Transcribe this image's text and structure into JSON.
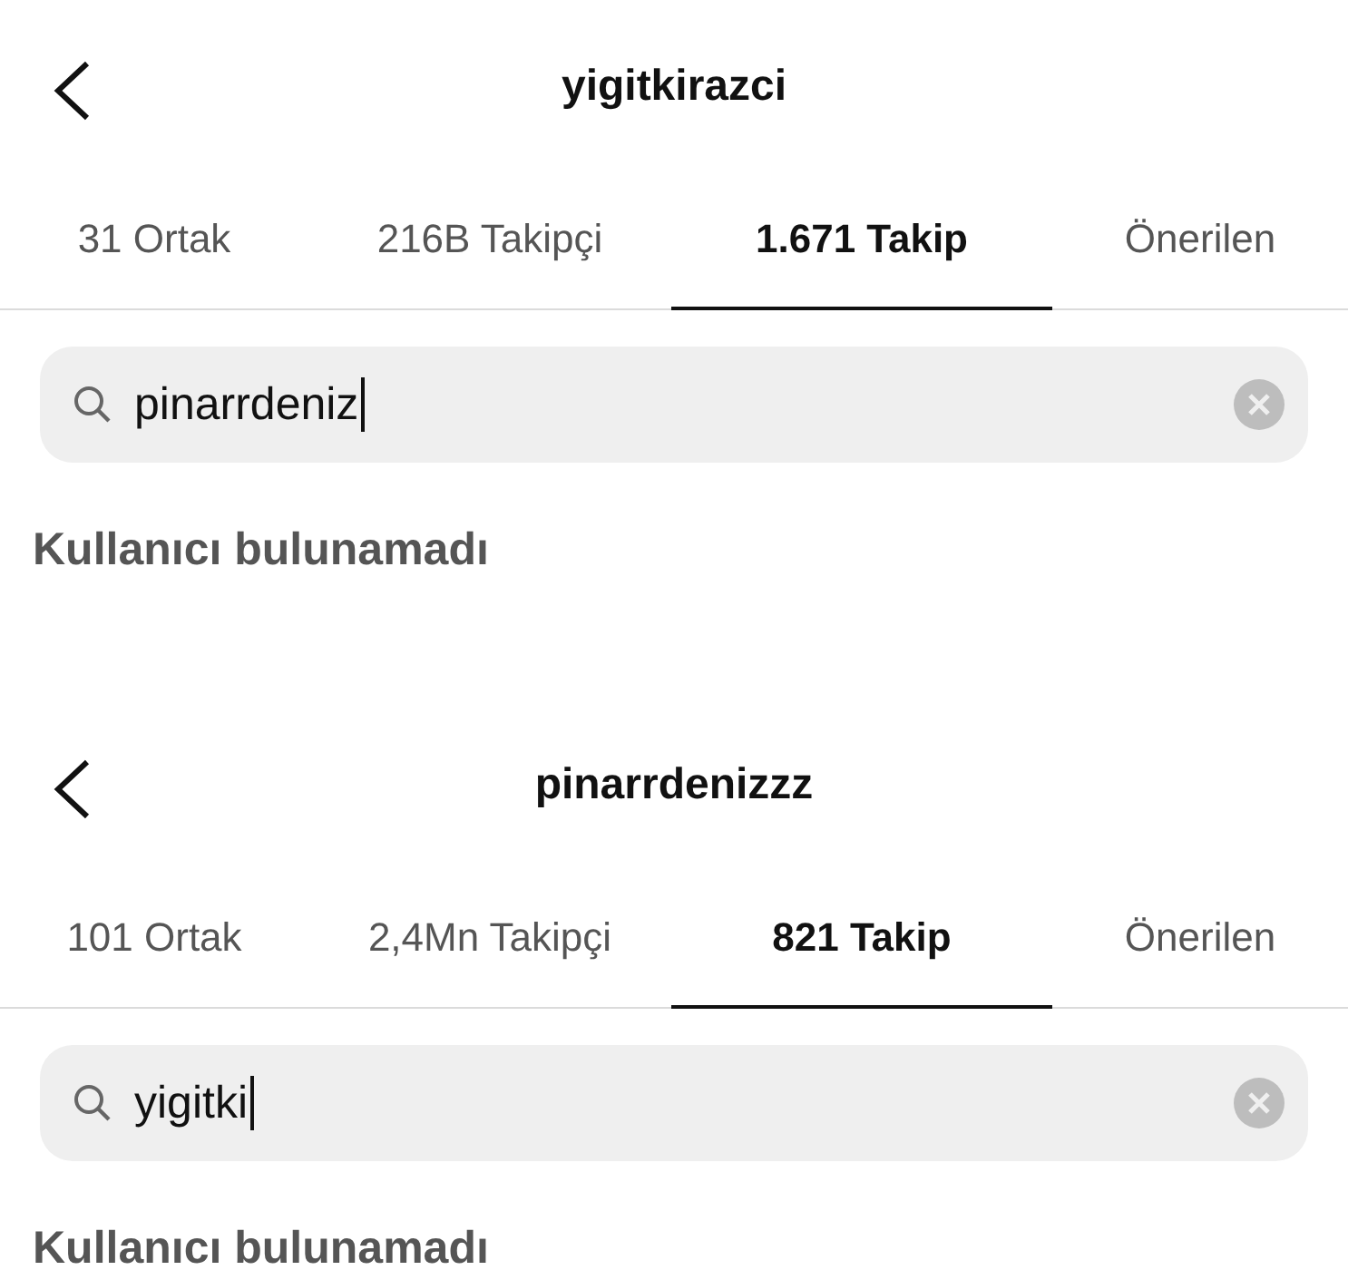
{
  "panels": [
    {
      "title": "yigitkirazci",
      "tabs": [
        {
          "label": "31 Ortak",
          "selected": false
        },
        {
          "label": "216B Takipçi",
          "selected": false
        },
        {
          "label": "1.671 Takip",
          "selected": true
        },
        {
          "label": "Önerilen",
          "selected": false
        }
      ],
      "search": {
        "value": "pinarrdeniz"
      },
      "message": "Kullanıcı bulunamadı"
    },
    {
      "title": "pinarrdenizzz",
      "tabs": [
        {
          "label": "101 Ortak",
          "selected": false
        },
        {
          "label": "2,4Mn Takipçi",
          "selected": false
        },
        {
          "label": "821 Takip",
          "selected": true
        },
        {
          "label": "Önerilen",
          "selected": false
        }
      ],
      "search": {
        "value": "yigitki"
      },
      "message": "Kullanıcı bulunamadı"
    }
  ]
}
